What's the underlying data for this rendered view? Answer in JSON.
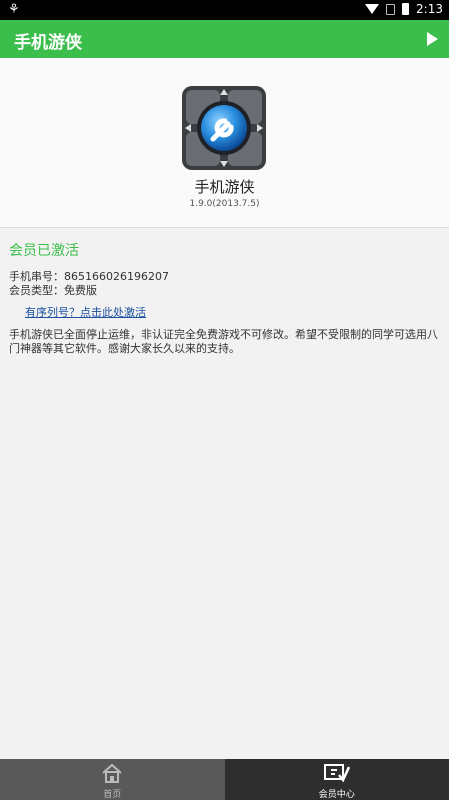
{
  "status_bar": {
    "left_icon": "notification-icon",
    "time": "2:13"
  },
  "app_bar": {
    "title": "手机游侠"
  },
  "hero": {
    "app_name": "手机游侠",
    "version": "1.9.0(2013.7.5)"
  },
  "membership": {
    "title": "会员已激活",
    "serial_label": "手机串号：",
    "serial_value": "865166026196207",
    "type_label": "会员类型：",
    "type_value": "免费版",
    "activate_link": "有序列号？点击此处激活",
    "notice": "手机游侠已全面停止运维，非认证完全免费游戏不可修改。希望不受限制的同学可选用八门神器等其它软件。感谢大家长久以来的支持。"
  },
  "bottom_nav": {
    "tabs": [
      {
        "label": "首页",
        "icon": "home-icon",
        "active": false
      },
      {
        "label": "会员中心",
        "icon": "member-center-icon",
        "active": true
      }
    ]
  },
  "colors": {
    "accent": "#3cbe4c",
    "link": "#1b4fa0",
    "nav_active": "#2e2e2e",
    "nav_inactive": "#595959"
  }
}
